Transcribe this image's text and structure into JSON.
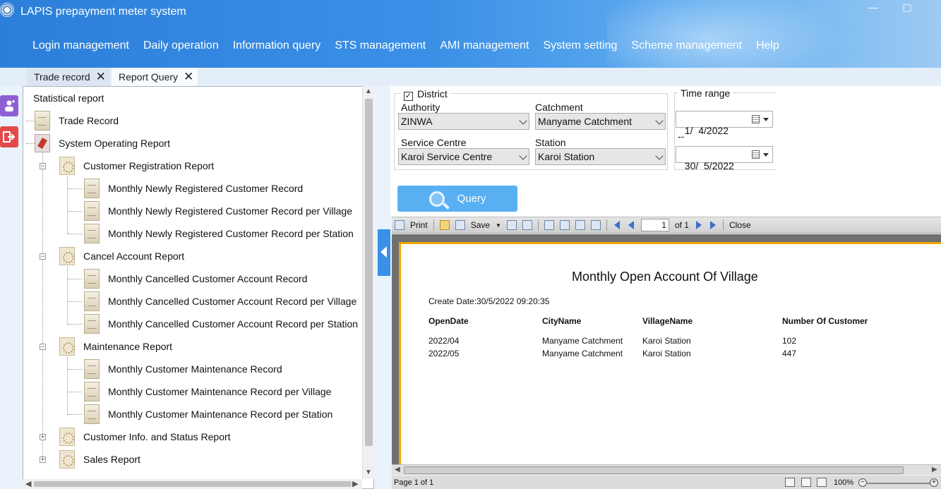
{
  "app": {
    "title": "LAPIS prepayment meter system"
  },
  "window": {
    "minimize": "—",
    "maximize": "▢"
  },
  "menu": [
    "Login management",
    "Daily operation",
    "Information query",
    "STS management",
    "AMI management",
    "System setting",
    "Scheme management",
    "Help"
  ],
  "tabs": [
    {
      "label": "Trade record"
    },
    {
      "label": "Report Query"
    }
  ],
  "tree": {
    "root": "Statistical report",
    "items": [
      "Trade Record",
      "System Operating Report",
      "Customer Registration Report",
      "Monthly Newly Registered Customer Record",
      "Monthly Newly Registered Customer Record per Village",
      "Monthly Newly Registered Customer Record per Station",
      "Cancel Account Report",
      "Monthly Cancelled Customer Account Record",
      "Monthly Cancelled Customer Account Record per Village",
      "Monthly Cancelled Customer Account Record per Station",
      "Maintenance Report",
      "Monthly Customer Maintenance Record",
      "Monthly Customer Maintenance Record per Village",
      "Monthly Customer Maintenance Record per Station",
      "Customer Info. and Status Report",
      "Sales Report"
    ]
  },
  "filters": {
    "district_label": "District",
    "authority_label": "Authority",
    "authority_value": "ZINWA",
    "catchment_label": "Catchment",
    "catchment_value": "Manyame Catchment",
    "service_centre_label": "Service Centre",
    "service_centre_value": "Karoi Service Centre",
    "station_label": "Station",
    "station_value": "Karoi Station",
    "time_range_label": "Time range",
    "date_from": "1/  4/2022",
    "date_sep": "--",
    "date_to": "30/  5/2022",
    "query_label": "Query"
  },
  "viewer": {
    "print": "Print",
    "save": "Save",
    "page": "1",
    "of": "of 1",
    "close": "Close",
    "status_page": "Page 1 of 1",
    "zoom": "100%"
  },
  "report": {
    "title": "Monthly Open Account Of Village",
    "create_date": "Create Date:30/5/2022 09:20:35",
    "columns": [
      "OpenDate",
      "CityName",
      "VillageName",
      "Number Of Customer"
    ],
    "rows": [
      [
        "2022/04",
        "Manyame Catchment",
        "Karoi Station",
        "102"
      ],
      [
        "2022/05",
        "Manyame Catchment",
        "Karoi Station",
        "447"
      ]
    ]
  }
}
